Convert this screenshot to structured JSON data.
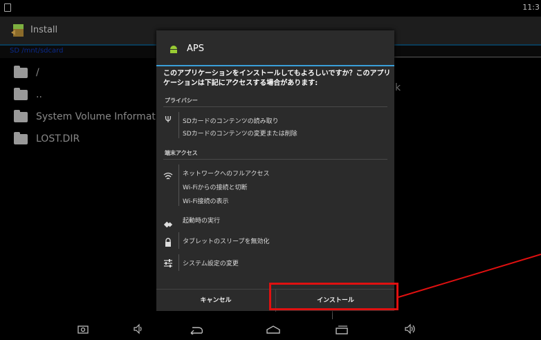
{
  "status": {
    "time": "11:3"
  },
  "app": {
    "title": "Install"
  },
  "pathbar": {
    "path": "SD   /mnt/sdcard"
  },
  "files": [
    {
      "name": "/"
    },
    {
      "name": ".."
    },
    {
      "name": "System Volume Information"
    },
    {
      "name": "LOST.DIR"
    }
  ],
  "background_right_char": "k",
  "dialog": {
    "title": "APS",
    "message": "このアプリケーションをインストールしてもよろしいですか？このアプリケーションは下記にアクセスする場合があります:",
    "privacy_header": "プライバシー",
    "privacy_items": [
      "SDカードのコンテンツの読み取り",
      "SDカードのコンテンツの変更または削除"
    ],
    "device_header": "端末アクセス",
    "network_items": [
      "ネットワークへのフルアクセス",
      "Wi-Fiからの接続と切断",
      "Wi-Fi接続の表示"
    ],
    "startup_item": "起動時の実行",
    "sleep_item": "タブレットのスリープを無効化",
    "settings_item": "システム設定の変更",
    "cancel_label": "キャンセル",
    "install_label": "インストール"
  },
  "colors": {
    "accent": "#3a9fd9",
    "highlight": "#e01010"
  },
  "icons": [
    "usb-icon",
    "wifi-icon",
    "startup-icon",
    "lock-icon",
    "settings-sliders-icon",
    "camera-icon",
    "volume-down-icon",
    "back-icon",
    "home-icon",
    "recent-apps-icon",
    "volume-up-icon"
  ]
}
